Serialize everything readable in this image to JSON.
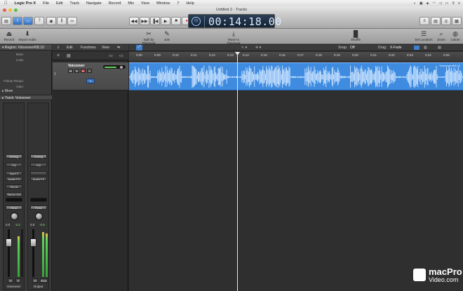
{
  "menubar": {
    "apple": "",
    "app": "Logic Pro X",
    "items": [
      "File",
      "Edit",
      "Track",
      "Navigate",
      "Record",
      "Mix",
      "View",
      "Window",
      "7",
      "Help"
    ]
  },
  "window": {
    "title": "Untitled 2 - Tracks"
  },
  "lcd": {
    "time": "00:14:18.00"
  },
  "toolbar2": {
    "tools": [
      {
        "label": "Record",
        "icon": "mic-icon"
      },
      {
        "label": "Import Audio",
        "icon": "download-icon"
      },
      {
        "label": "Split by Playhead",
        "icon": "scissors-icon"
      },
      {
        "label": "Join",
        "icon": "glue-icon"
      },
      {
        "label": "Move to Playhead",
        "icon": "playhead-icon"
      },
      {
        "label": "Shuffle",
        "icon": "shuffle-icon"
      },
      {
        "label": "Set Locators",
        "icon": "locators-icon"
      },
      {
        "label": "Zoom",
        "icon": "zoom-icon"
      },
      {
        "label": "Colors",
        "icon": "palette-icon"
      }
    ]
  },
  "inspector": {
    "region_header": "Region: Voiceover#08.10",
    "params": [
      "Mute:",
      "Loop:",
      "",
      "Follow Tempo:",
      "Gain:"
    ],
    "more": "More",
    "track_header": "Track: Voiceover"
  },
  "channel_strips": [
    {
      "name": "Voiceover",
      "setting": "Setting",
      "eq": "EQ",
      "input": "Input 2",
      "slot1": "Audio FX",
      "slot2": "Sends",
      "output": "Stereo Out",
      "group": "Read",
      "val_left": "0.0",
      "val_right": "-3.2",
      "m": "M",
      "s": "S"
    },
    {
      "name": "Output",
      "setting": "Setting",
      "eq": "EQ",
      "input": "",
      "slot1": "Audio FX",
      "slot2": "",
      "output": "",
      "group": "Read",
      "val_left": "0.0",
      "val_right": "-0.6",
      "m": "M",
      "s": "Bnce"
    }
  ],
  "trackhdr_toolbar": {
    "edit": "Edit",
    "functions": "Functions",
    "view": "View",
    "snap_label": "Snap:",
    "snap_value": "Off",
    "drag_label": "Drag:",
    "drag_value": "X-Fade"
  },
  "track": {
    "number": "1",
    "name": "Voiceover",
    "m": "M",
    "s": "S",
    "r": "R",
    "i": "I",
    "volume_fraction": 0.6
  },
  "region": {
    "name": "Voiceover#08.10"
  },
  "ruler": {
    "ticks": [
      "0:00",
      "0:09",
      "0:10",
      "0:11",
      "0:12",
      "0:13",
      "0:14",
      "0:15",
      "0:16",
      "0:17",
      "0:18",
      "0:19",
      "0:20",
      "0:21",
      "0:22",
      "0:23",
      "0:24",
      "0:25"
    ]
  },
  "watermark": {
    "line1": "macPro",
    "line2": "Video.com"
  }
}
